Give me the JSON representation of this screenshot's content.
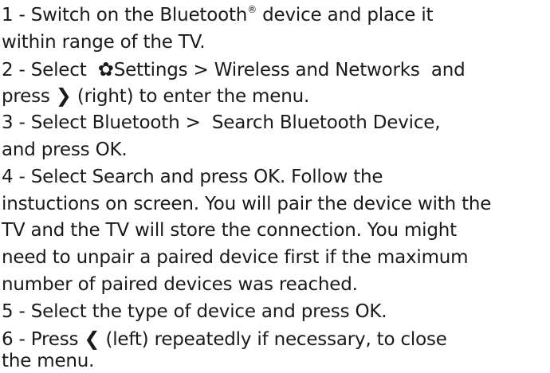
{
  "step1": {
    "num": "1 - ",
    "text_a": "Switch on the Bluetooth",
    "reg": "®",
    "text_b": " device and place it",
    "cont": "within range of the TV."
  },
  "step2": {
    "num": "2 - ",
    "select": "Select ",
    "settings": "Settings",
    "sep": " > ",
    "wireless": "Wireless and Networks",
    "and": "  and",
    "press": "press ",
    "right_hint": " (right) to enter the menu."
  },
  "step3": {
    "num": "3 - ",
    "select": "Select ",
    "bluetooth": "Bluetooth",
    "sep": " >  ",
    "search_device": "Search Bluetooth Device",
    "comma": ",",
    "and_press": "and press ",
    "ok": "OK",
    "period": "."
  },
  "step4": {
    "num": "4 - ",
    "select": "Select ",
    "search": "Search",
    "and_press": " and press ",
    "ok": "OK",
    "follow": ". Follow the",
    "line2": "instuctions on screen. You will pair the device with the",
    "line3": "TV and the TV will store the connection. You might",
    "line4": "need to unpair a paired device first if the maximum",
    "line5": "number of paired devices was reached."
  },
  "step5": {
    "num": "5 - ",
    "text": "Select the type of device and press ",
    "ok": "OK",
    "period": "."
  },
  "step6": {
    "num": "6 - ",
    "press": "Press ",
    "left_hint": " (left) repeatedly if necessary, to close",
    "cont": "the menu."
  },
  "icons": {
    "gear": "✿",
    "right": "❯",
    "left": "❮"
  }
}
